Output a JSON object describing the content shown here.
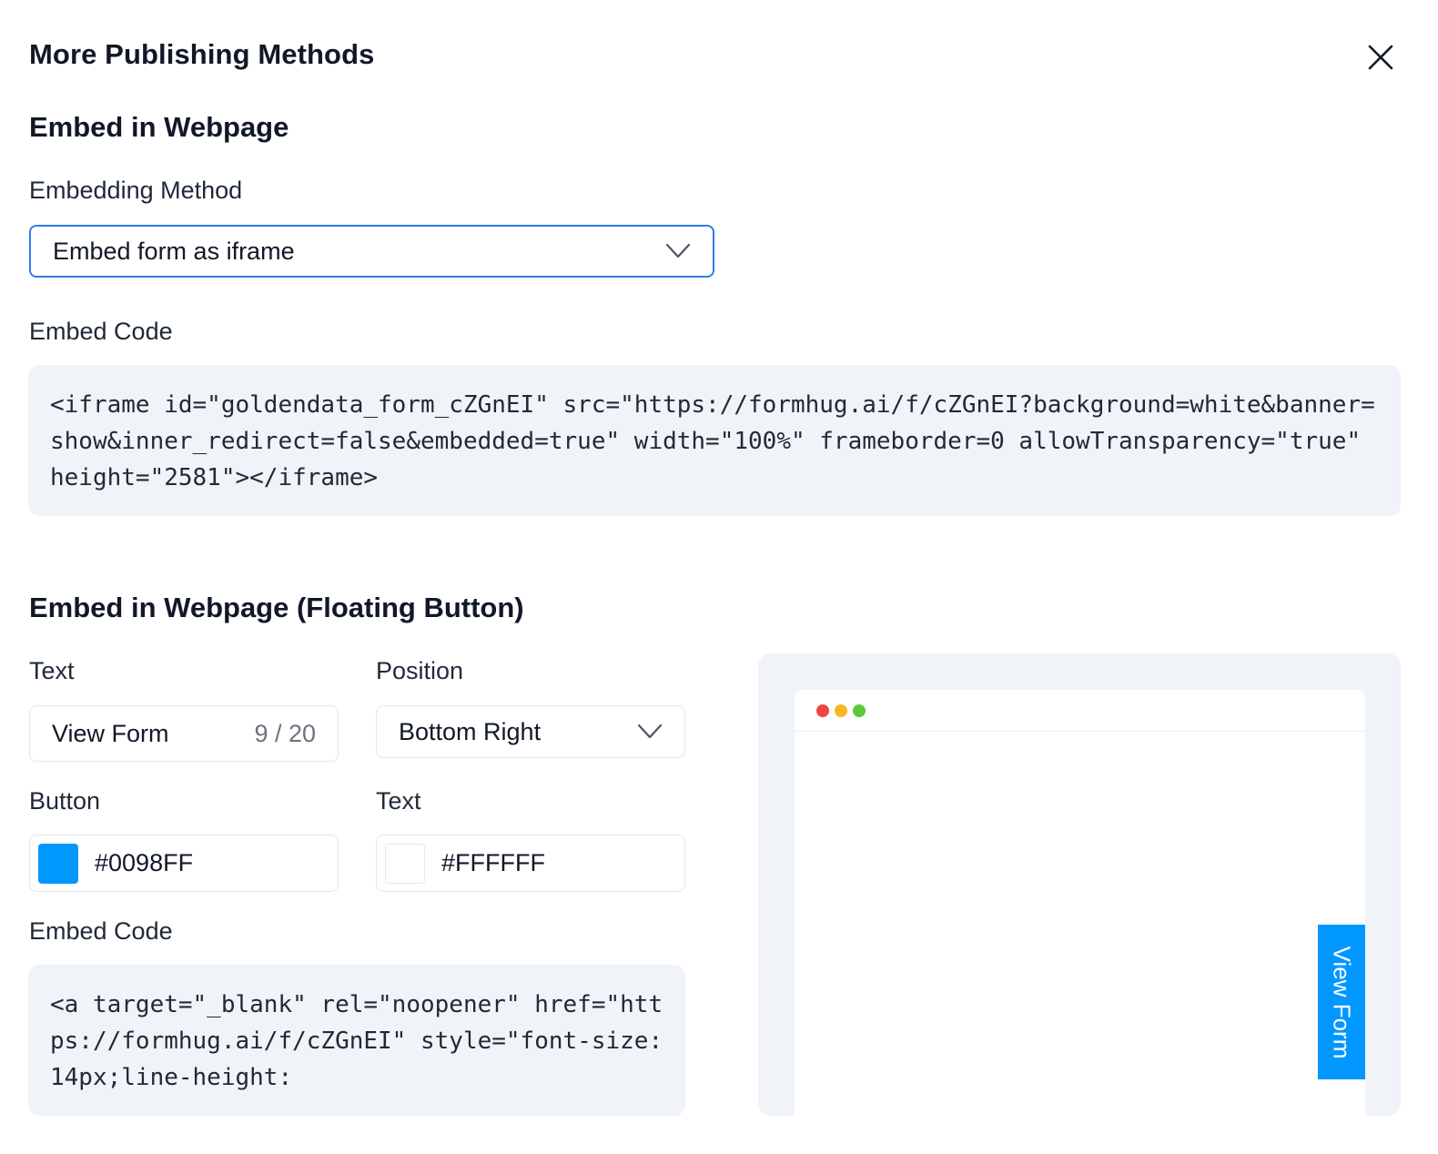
{
  "dialog": {
    "title": "More Publishing Methods"
  },
  "iframe_section": {
    "title": "Embed in Webpage",
    "method_label": "Embedding Method",
    "method_value": "Embed form as iframe",
    "code_label": "Embed Code",
    "code": "<iframe id=\"goldendata_form_cZGnEI\" src=\"https://formhug.ai/f/cZGnEI?background=white&banner=show&inner_redirect=false&embedded=true\" width=\"100%\" frameborder=0 allowTransparency=\"true\" height=\"2581\"></iframe>"
  },
  "floating_section": {
    "title": "Embed in Webpage (Floating Button)",
    "text_label": "Text",
    "text_value": "View Form",
    "text_count": "9 / 20",
    "position_label": "Position",
    "position_value": "Bottom Right",
    "button_color_label": "Button",
    "button_color": "#0098FF",
    "text_color_label": "Text",
    "text_color": "#FFFFFF",
    "code_label": "Embed Code",
    "code": "<a target=\"_blank\" rel=\"noopener\" href=\"https://formhug.ai/f/cZGnEI\" style=\"font-size: 14px;line-height:",
    "preview_button_text": "View Form"
  },
  "colors": {
    "accent": "#2f7de1",
    "button": "#0098ff",
    "dot_red": "#ef4444",
    "dot_yellow": "#f5b821",
    "dot_green": "#5cc83b"
  },
  "icons": {
    "close": "close-icon",
    "dropdown": "chevron-down-icon"
  }
}
